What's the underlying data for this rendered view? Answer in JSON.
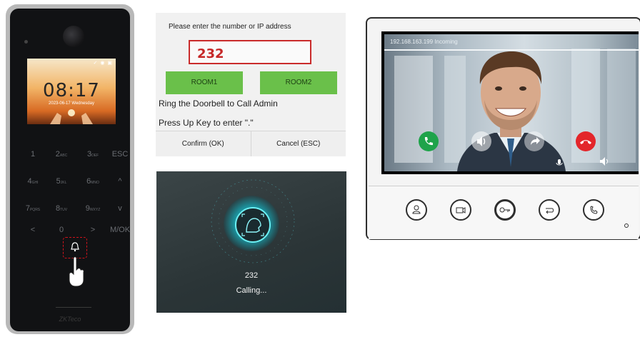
{
  "terminal": {
    "clock": "08:17",
    "date": "2023-06-17 Wednesday",
    "brand": "ZKTeco",
    "keys": [
      {
        "main": "1",
        "sub": ""
      },
      {
        "main": "2",
        "sub": "ABC"
      },
      {
        "main": "3",
        "sub": "DEF"
      },
      {
        "main": "ESC",
        "sub": ""
      },
      {
        "main": "4",
        "sub": "GHI"
      },
      {
        "main": "5",
        "sub": "JKL"
      },
      {
        "main": "6",
        "sub": "MNO"
      },
      {
        "main": "^",
        "sub": ""
      },
      {
        "main": "7",
        "sub": "PQRS"
      },
      {
        "main": "8",
        "sub": "TUV"
      },
      {
        "main": "9",
        "sub": "WXYZ"
      },
      {
        "main": "v",
        "sub": ""
      },
      {
        "main": "<",
        "sub": ""
      },
      {
        "main": "0",
        "sub": ""
      },
      {
        "main": ">",
        "sub": ""
      },
      {
        "main": "M/OK",
        "sub": ""
      }
    ]
  },
  "dialog": {
    "prompt": "Please enter the number or IP address",
    "number_value": "232",
    "room1_label": "ROOM1",
    "room2_label": "ROOM2",
    "hint1": "Ring the Doorbell to Call Admin",
    "hint2": "Press Up Key to enter \".\"",
    "confirm_label": "Confirm (OK)",
    "cancel_label": "Cancel (ESC)"
  },
  "calling": {
    "number": "232",
    "status": "Calling..."
  },
  "monitor": {
    "caption": "192.168.163.199 Incoming",
    "colors": {
      "answer": "#1fa34a",
      "hangup": "#e3262b"
    }
  }
}
